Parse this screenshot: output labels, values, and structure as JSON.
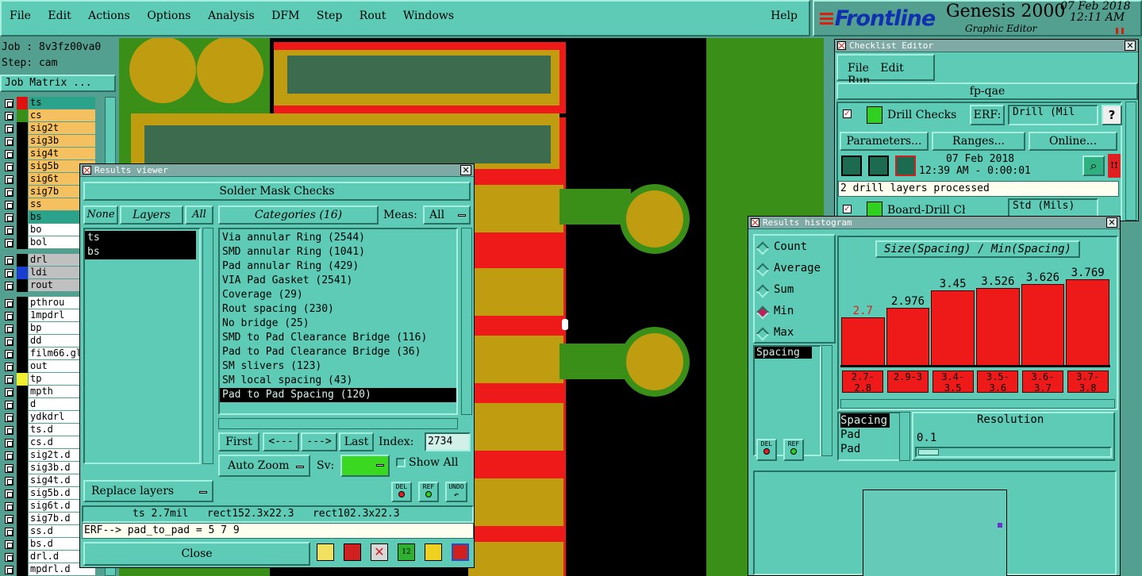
{
  "menu": {
    "file": "File",
    "edit": "Edit",
    "actions": "Actions",
    "options": "Options",
    "analysis": "Analysis",
    "dfm": "DFM",
    "step": "Step",
    "rout": "Rout",
    "windows": "Windows",
    "help": "Help"
  },
  "brand": {
    "logo": "Frontline",
    "product": "Genesis 2000",
    "subtitle": "Graphic Editor",
    "date": "07 Feb 2018",
    "time": "12:11 AM"
  },
  "job": {
    "job_label": "Job : 8v3fz00va0",
    "step_label": "Step: cam",
    "matrix_button": "Job Matrix ..."
  },
  "layers": [
    {
      "name": "ts",
      "color": "#2aa38a",
      "swatch": "#e01010"
    },
    {
      "name": "cs",
      "color": "#f5c060",
      "swatch": "#3a8f18"
    },
    {
      "name": "sig2t",
      "color": "#f5c060",
      "swatch": "#000000"
    },
    {
      "name": "sig3b",
      "color": "#f5c060",
      "swatch": "#000000"
    },
    {
      "name": "sig4t",
      "color": "#f5c060",
      "swatch": "#000000"
    },
    {
      "name": "sig5b",
      "color": "#f5c060",
      "swatch": "#000000"
    },
    {
      "name": "sig6t",
      "color": "#f5c060",
      "swatch": "#000000"
    },
    {
      "name": "sig7b",
      "color": "#f5c060",
      "swatch": "#000000"
    },
    {
      "name": "ss",
      "color": "#f5c060",
      "swatch": "#000000"
    },
    {
      "name": "bs",
      "color": "#2aa38a",
      "swatch": "#000000"
    },
    {
      "name": "bo",
      "color": "#ffffff",
      "swatch": "#000000"
    },
    {
      "name": "bol",
      "color": "#ffffff",
      "swatch": "#000000"
    },
    {
      "name": "drl",
      "color": "#c0c0c0",
      "swatch": "#000000"
    },
    {
      "name": "ldi",
      "color": "#c0c0c0",
      "swatch": "#1a3fd0"
    },
    {
      "name": "rout",
      "color": "#c0c0c0",
      "swatch": "#000000"
    },
    {
      "name": "pthrou",
      "color": "#ffffff",
      "swatch": "#000000"
    },
    {
      "name": "1mpdrl",
      "color": "#ffffff",
      "swatch": "#000000"
    },
    {
      "name": "bp",
      "color": "#ffffff",
      "swatch": "#000000"
    },
    {
      "name": "dd",
      "color": "#ffffff",
      "swatch": "#000000"
    },
    {
      "name": "film66.gl",
      "color": "#ffffff",
      "swatch": "#000000"
    },
    {
      "name": "out",
      "color": "#ffffff",
      "swatch": "#000000"
    },
    {
      "name": "tp",
      "color": "#ffffff",
      "swatch": "#f0f030"
    },
    {
      "name": "mpth",
      "color": "#ffffff",
      "swatch": "#000000"
    },
    {
      "name": "d",
      "color": "#ffffff",
      "swatch": "#000000"
    },
    {
      "name": "ydkdrl",
      "color": "#ffffff",
      "swatch": "#000000"
    },
    {
      "name": "ts.d",
      "color": "#ffffff",
      "swatch": "#000000"
    },
    {
      "name": "cs.d",
      "color": "#ffffff",
      "swatch": "#000000"
    },
    {
      "name": "sig2t.d",
      "color": "#ffffff",
      "swatch": "#000000"
    },
    {
      "name": "sig3b.d",
      "color": "#ffffff",
      "swatch": "#000000"
    },
    {
      "name": "sig4t.d",
      "color": "#ffffff",
      "swatch": "#000000"
    },
    {
      "name": "sig5b.d",
      "color": "#ffffff",
      "swatch": "#000000"
    },
    {
      "name": "sig6t.d",
      "color": "#ffffff",
      "swatch": "#000000"
    },
    {
      "name": "sig7b.d",
      "color": "#ffffff",
      "swatch": "#000000"
    },
    {
      "name": "ss.d",
      "color": "#ffffff",
      "swatch": "#000000"
    },
    {
      "name": "bs.d",
      "color": "#ffffff",
      "swatch": "#000000"
    },
    {
      "name": "drl.d",
      "color": "#ffffff",
      "swatch": "#000000"
    },
    {
      "name": "mpdrl.d",
      "color": "#ffffff",
      "swatch": "#000000"
    }
  ],
  "results_viewer": {
    "title": "Results viewer",
    "header": "Solder Mask Checks",
    "none_btn": "None",
    "layers_label": "Layers",
    "all_btn": "All",
    "layer_list": [
      "ts",
      "bs"
    ],
    "categories_label": "Categories (16)",
    "meas_label": "Meas:",
    "meas_value": "All",
    "categories": [
      "Via annular Ring (2544)",
      "SMD annular Ring (1041)",
      "Pad annular Ring (429)",
      "VIA Pad Gasket (2541)",
      "Coverage (29)",
      "Rout spacing (230)",
      "No bridge (25)",
      "SMD to Pad Clearance Bridge (116)",
      "Pad to Pad Clearance Bridge (36)",
      "SM slivers (123)",
      "SM local spacing (43)",
      "Pad to Pad Spacing (120)"
    ],
    "first": "First",
    "prev": "<---",
    "next": "--->",
    "last": "Last",
    "index_label": "Index:",
    "index_value": "2734",
    "auto_zoom": "Auto Zoom",
    "sv_label": "Sv:",
    "show_all": "Show All",
    "replace_layers": "Replace layers",
    "del": "DEL",
    "ref": "REF",
    "undo": "UNDO",
    "status": "ts 2.7mil   rect152.3x22.3   rect102.3x22.3",
    "erf_line": "ERF--> pad_to_pad = 5 7 9",
    "close": "Close"
  },
  "checklist": {
    "title": "Checklist Editor",
    "file": "File",
    "edit": "Edit",
    "run": "Run",
    "name": "fp-qae",
    "drill_checks": "Drill Checks",
    "erf": "ERF:",
    "drill_erf": "Drill (Mil",
    "help": "?",
    "parameters": "Parameters...",
    "ranges": "Ranges...",
    "online": "Online...",
    "date": "07 Feb 2018",
    "time": "12:39 AM - 0:00:01",
    "message": "2 drill layers processed",
    "board_drill": "Board-Drill Che",
    "board_erf": "Std (Mils)",
    "alert": "!!"
  },
  "histogram": {
    "title": "Results histogram",
    "modes": [
      "Count",
      "Average",
      "Sum",
      "Min",
      "Max"
    ],
    "selected_mode": "Min",
    "chart_title": "Size(Spacing) / Min(Spacing)",
    "values": [
      "2.7",
      "2.976",
      "3.45",
      "3.526",
      "3.626",
      "3.769"
    ],
    "ranges": [
      "2.7-2.8",
      "2.9-3",
      "3.4-3.5",
      "3.5-3.6",
      "3.6-3.7",
      "3.7-3.8"
    ],
    "list_selected": "Spacing",
    "props": [
      "Spacing",
      "Pad",
      "Pad"
    ],
    "resolution_label": "Resolution",
    "resolution_value": "0.1",
    "del": "DEL",
    "ref": "REF"
  },
  "chart_data": {
    "type": "bar",
    "title": "Size(Spacing) / Min(Spacing)",
    "categories": [
      "2.7-2.8",
      "2.9-3",
      "3.4-3.5",
      "3.5-3.6",
      "3.6-3.7",
      "3.7-3.8"
    ],
    "values": [
      2.7,
      2.976,
      3.45,
      3.526,
      3.626,
      3.769
    ],
    "colors": {
      "bar": "#ee1a1a",
      "first_label": "#e02020"
    }
  }
}
